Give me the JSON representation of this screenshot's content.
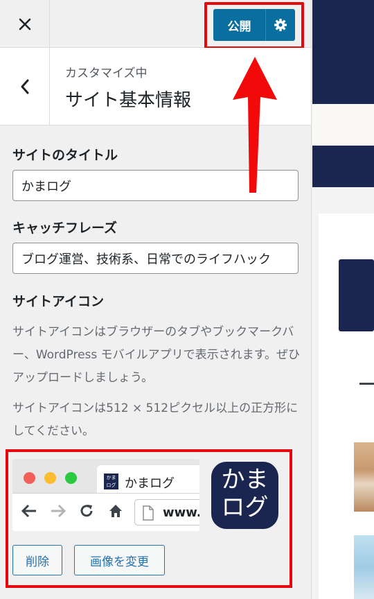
{
  "topbar": {
    "close_icon": "close-icon",
    "publish_label": "公開",
    "gear_icon": "gear-icon"
  },
  "section": {
    "subtitle": "カスタマイズ中",
    "title": "サイト基本情報",
    "back_icon": "chevron-left-icon"
  },
  "site_title": {
    "label": "サイトのタイトル",
    "value": "かまログ"
  },
  "tagline": {
    "label": "キャッチフレーズ",
    "value": "ブログ運営、技術系、日常でのライフハック"
  },
  "site_icon": {
    "label": "サイトアイコン",
    "description": "サイトアイコンはブラウザーのタブやブックマークバー、WordPress モバイルアプリで表示されます。ぜひアップロードしましょう。",
    "size_note": "サイトアイコンは512 × 512ピクセル以上の正方形にしてください。",
    "preview_tab_title": "かまログ",
    "preview_favicon_text": "かま ログ",
    "preview_url": "www.",
    "big_icon_line1": "かま",
    "big_icon_line2": "ログ",
    "remove_label": "削除",
    "change_label": "画像を変更"
  },
  "colors": {
    "accent": "#0a6fa0",
    "highlight": "#e8060e",
    "brand_navy": "#1a2550"
  }
}
